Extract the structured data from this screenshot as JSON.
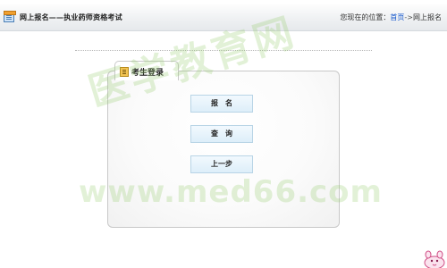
{
  "header": {
    "title": "网上报名——执业药师资格考试",
    "location_label": "您现在的位置：",
    "home_link": "首页",
    "separator": "->",
    "current": "网上报名"
  },
  "panel": {
    "title": "考生登录"
  },
  "buttons": {
    "signup": "报　名",
    "query": "查　询",
    "back": "上一步"
  },
  "watermark": {
    "chinese": "医学教育网",
    "url": "www.med66.com"
  }
}
